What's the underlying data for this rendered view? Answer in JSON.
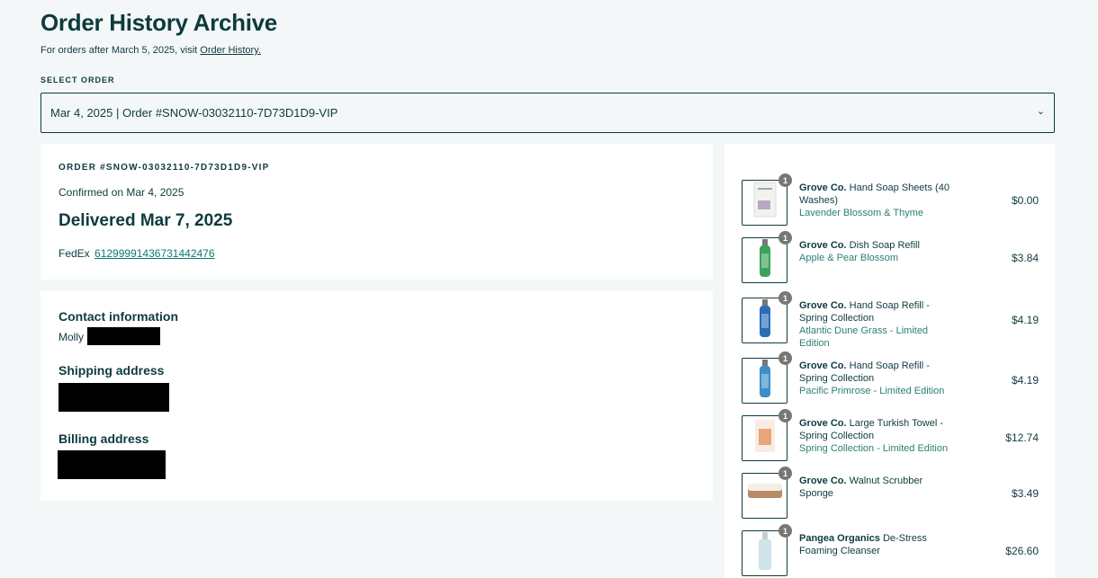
{
  "header": {
    "title": "Order History Archive",
    "subtitle_prefix": "For orders after March 5, 2025, visit ",
    "subtitle_link": "Order History."
  },
  "select": {
    "label": "SELECT ORDER",
    "value": "Mar 4, 2025 | Order #SNOW-03032110-7D73D1D9-VIP",
    "chevron": "⌄"
  },
  "order": {
    "number": "ORDER #SNOW-03032110-7D73D1D9-VIP",
    "confirmed": "Confirmed on Mar 4, 2025",
    "delivered": "Delivered Mar 7, 2025",
    "carrier": "FedEx",
    "tracking": "612999914367314424​76"
  },
  "contact": {
    "contact_heading": "Contact information",
    "contact_name": "Molly",
    "shipping_heading": "Shipping address",
    "billing_heading": "Billing address"
  },
  "items": [
    {
      "brand": "Grove Co.",
      "name": "Hand Soap Sheets (40 Washes)",
      "variant": "Lavender Blossom & Thyme",
      "price": "$0.00",
      "qty": "1",
      "icon": "soap-sheets-icon",
      "color": "#b9a7c8"
    },
    {
      "brand": "Grove Co.",
      "name": "Dish Soap Refill",
      "variant": "Apple & Pear Blossom",
      "price": "$3.84",
      "qty": "1",
      "icon": "dish-soap-bottle-icon",
      "color": "#3aa35a"
    },
    {
      "brand": "Grove Co.",
      "name": "Hand Soap Refill - Spring Collection",
      "variant": "Atlantic Dune Grass - Limited Edition",
      "price": "$4.19",
      "qty": "1",
      "icon": "hand-soap-bottle-icon",
      "color": "#2a6fb5"
    },
    {
      "brand": "Grove Co.",
      "name": "Hand Soap Refill - Spring Collection",
      "variant": "Pacific Primrose - Limited Edition",
      "price": "$4.19",
      "qty": "1",
      "icon": "hand-soap-bottle-icon",
      "color": "#3b8fc8"
    },
    {
      "brand": "Grove Co.",
      "name": "Large Turkish Towel - Spring Collection",
      "variant": "Spring Collection - Limited Edition",
      "price": "$12.74",
      "qty": "1",
      "icon": "towel-icon",
      "color": "#e8a47c"
    },
    {
      "brand": "Grove Co.",
      "name": "Walnut Scrubber Sponge",
      "variant": "",
      "price": "$3.49",
      "qty": "1",
      "icon": "sponge-icon",
      "color": "#b98a66"
    },
    {
      "brand": "Pangea Organics",
      "name": "De-Stress Foaming Cleanser",
      "variant": "",
      "price": "$26.60",
      "qty": "1",
      "icon": "cleanser-bottle-icon",
      "color": "#cfe3ea"
    }
  ]
}
